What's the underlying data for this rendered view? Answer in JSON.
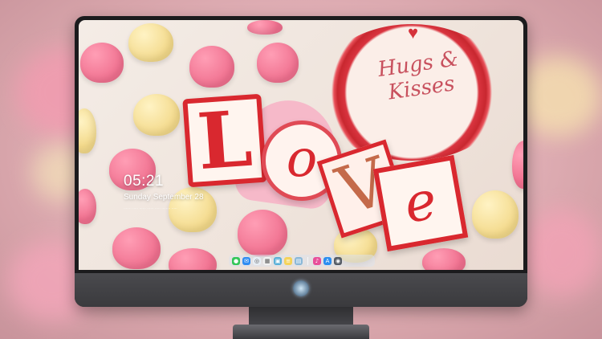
{
  "lockscreen": {
    "time": "05:21",
    "date": "Sunday September 28",
    "subline": "....... ..... ...... ...... ..... ........ ....."
  },
  "wallpaper": {
    "badge_line1": "Hugs &",
    "badge_line2": "Kisses",
    "letters": [
      "L",
      "o",
      "V",
      "e"
    ]
  },
  "dock": {
    "icons": [
      {
        "name": "messages-icon",
        "color": "#34c759",
        "glyph": "●"
      },
      {
        "name": "mail-icon",
        "color": "#2f8cf2",
        "glyph": "✉"
      },
      {
        "name": "safari-icon",
        "color": "#e7eef5",
        "glyph": "◎"
      },
      {
        "name": "calendar-icon",
        "color": "#f2f2f2",
        "glyph": "▦"
      },
      {
        "name": "preview-icon",
        "color": "#5ab0d8",
        "glyph": "▣"
      },
      {
        "name": "notes-icon",
        "color": "#f5d35a",
        "glyph": "≡"
      },
      {
        "name": "finder-icon",
        "color": "#8ab8d8",
        "glyph": "▤"
      },
      {
        "name": "music-icon",
        "color": "#e84f9a",
        "glyph": "♪"
      },
      {
        "name": "app-store-icon",
        "color": "#2c8ef0",
        "glyph": "A"
      },
      {
        "name": "camera-icon",
        "color": "#555c66",
        "glyph": "◉"
      }
    ]
  }
}
